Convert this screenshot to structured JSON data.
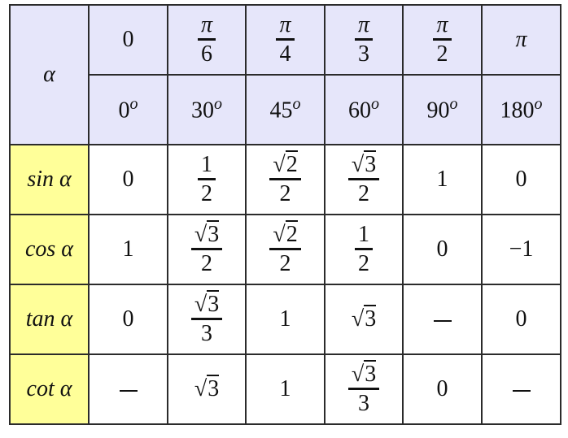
{
  "table": {
    "corner_label": "α",
    "radians": [
      {
        "num": "0",
        "den": ""
      },
      {
        "num": "π",
        "den": "6"
      },
      {
        "num": "π",
        "den": "4"
      },
      {
        "num": "π",
        "den": "3"
      },
      {
        "num": "π",
        "den": "2"
      },
      {
        "num": "π",
        "den": ""
      }
    ],
    "degrees": [
      {
        "value": "0",
        "unit": "o"
      },
      {
        "value": "30",
        "unit": "o"
      },
      {
        "value": "45",
        "unit": "o"
      },
      {
        "value": "60",
        "unit": "o"
      },
      {
        "value": "90",
        "unit": "o"
      },
      {
        "value": "180",
        "unit": "o"
      }
    ],
    "rows": [
      {
        "label": "sin α",
        "cells": [
          "0",
          "1/2",
          "√2/2",
          "√3/2",
          "1",
          "0"
        ]
      },
      {
        "label": "cos α",
        "cells": [
          "1",
          "√3/2",
          "√2/2",
          "1/2",
          "0",
          "−1"
        ]
      },
      {
        "label": "tan α",
        "cells": [
          "0",
          "√3/3",
          "1",
          "√3",
          "–",
          "0"
        ]
      },
      {
        "label": "cot α",
        "cells": [
          "–",
          "√3",
          "1",
          "√3/3",
          "0",
          "–"
        ]
      }
    ]
  },
  "colors": {
    "header_bg": "#e6e6fa",
    "function_label_bg": "#ffff99",
    "value_bg": "#ffffff"
  }
}
